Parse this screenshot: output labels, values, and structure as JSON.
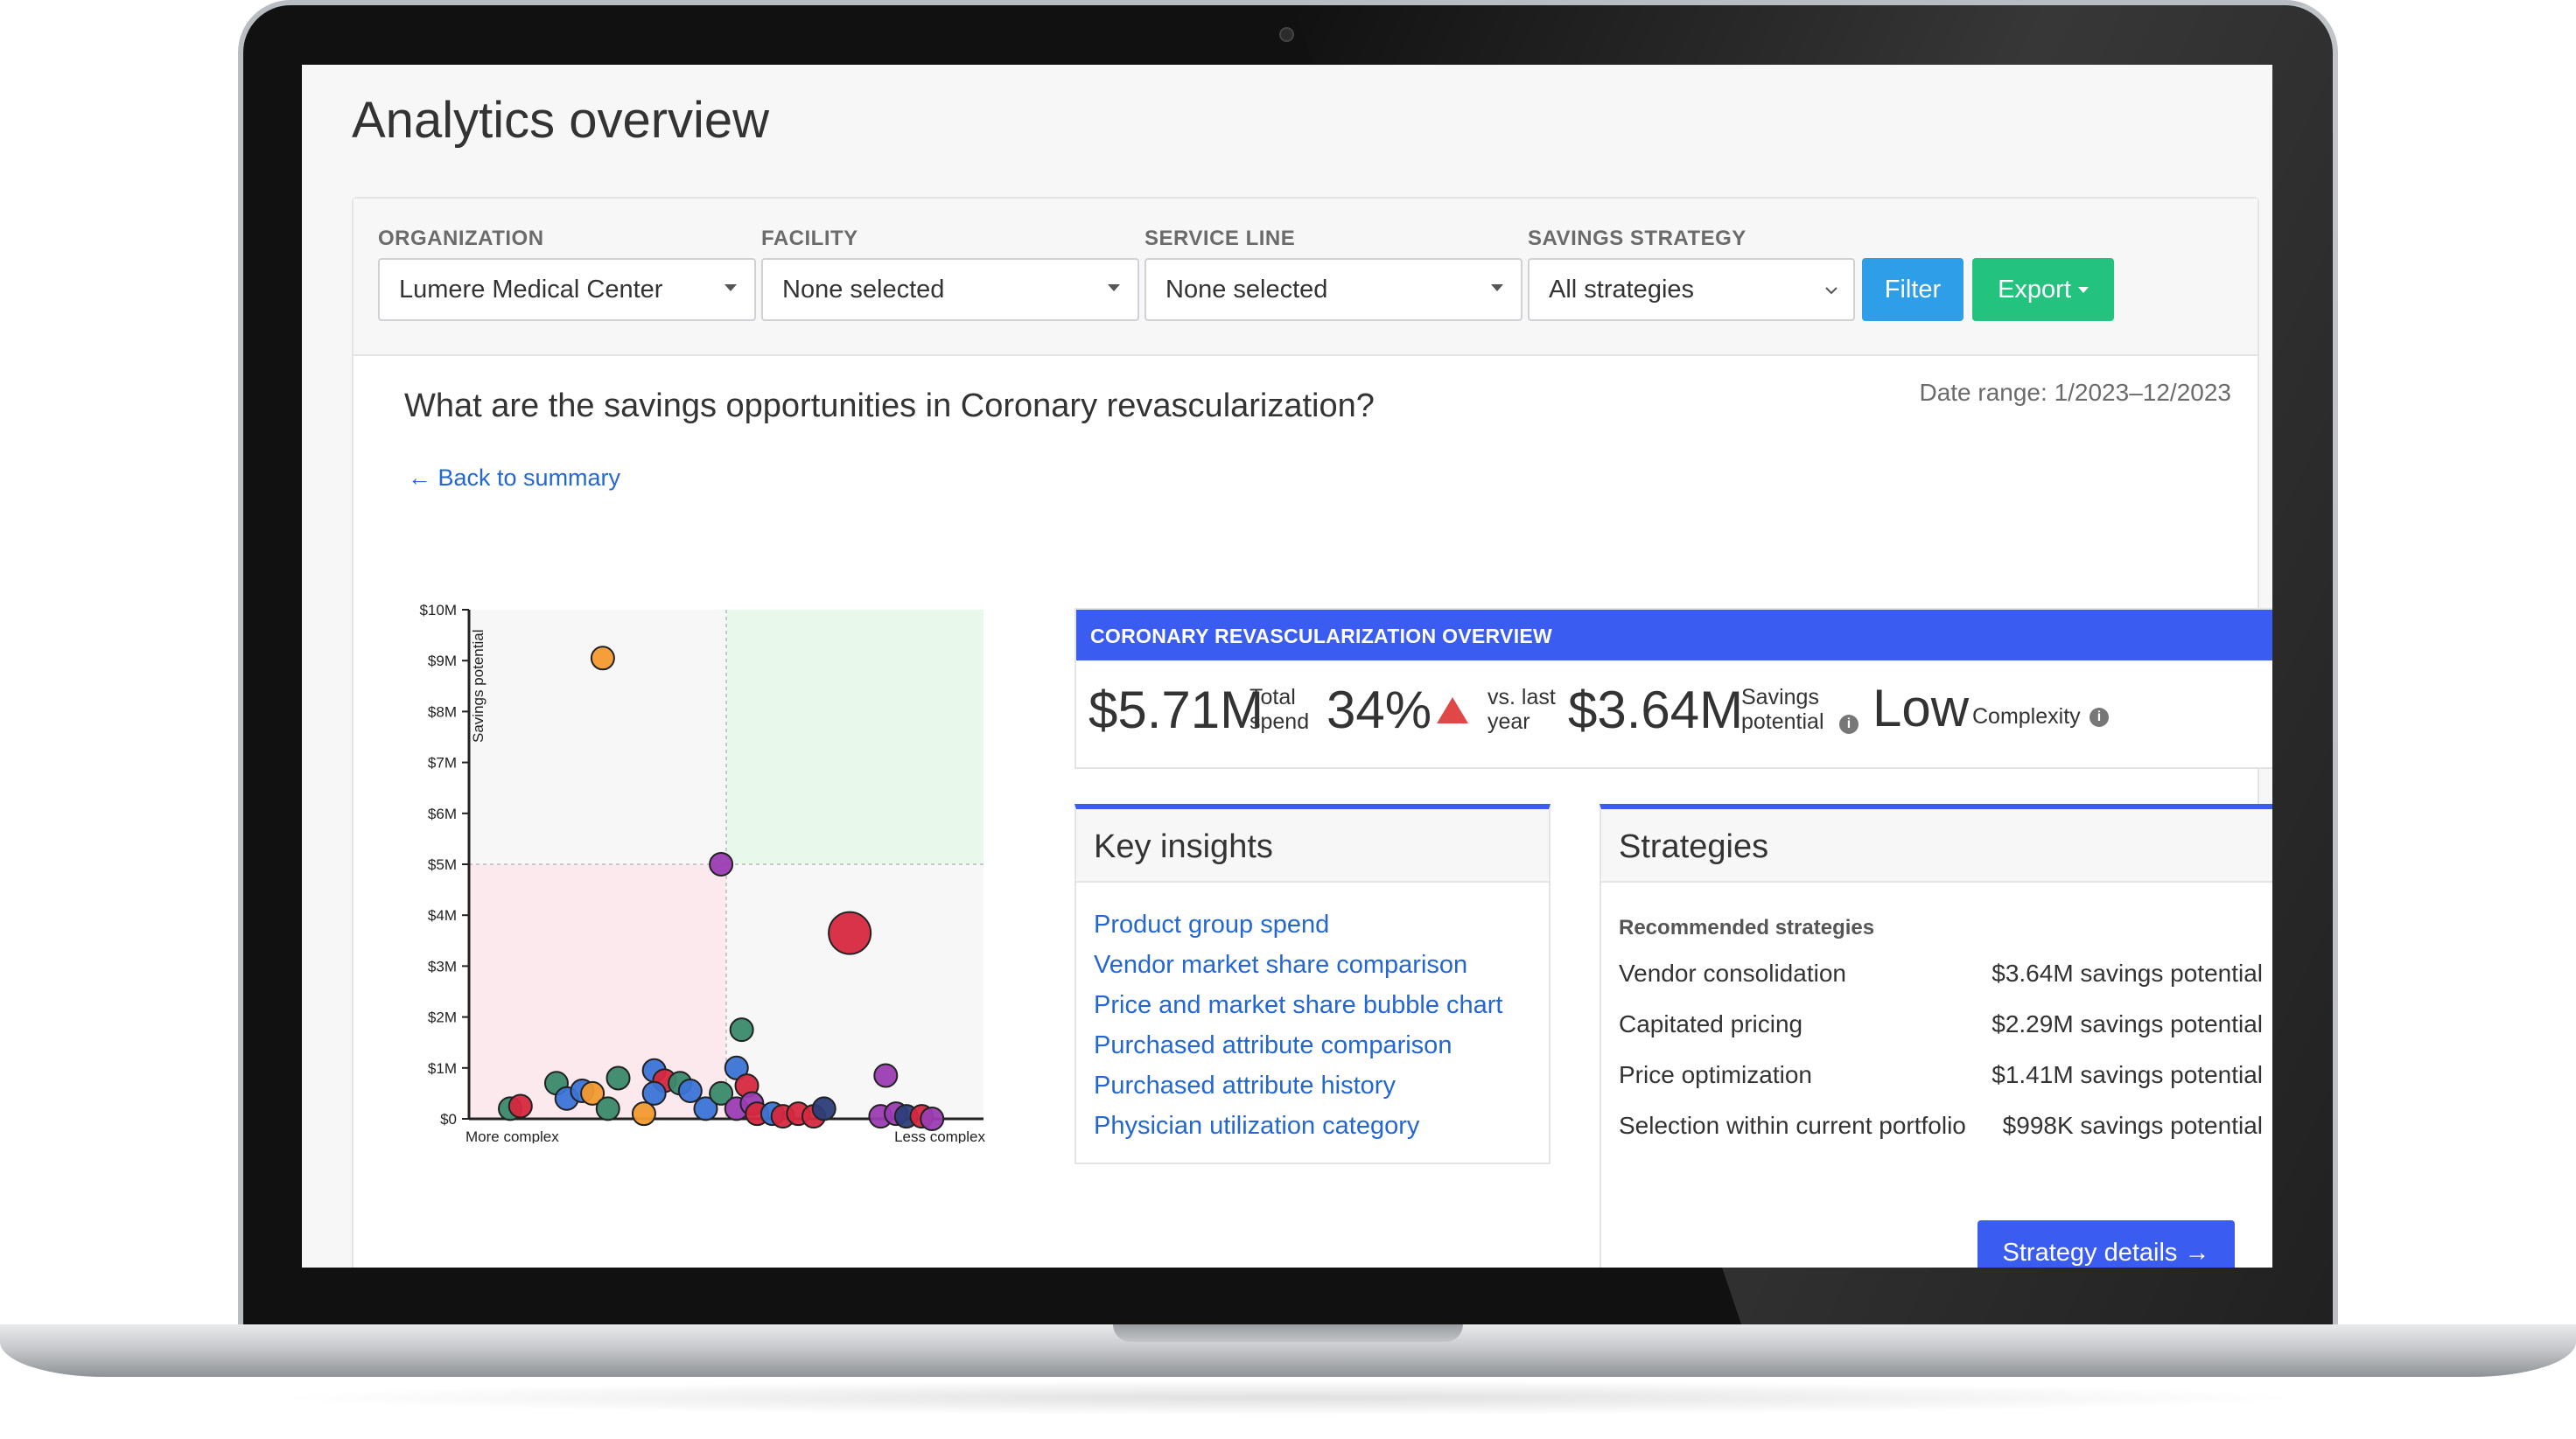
{
  "page": {
    "title": "Analytics overview"
  },
  "filters": {
    "organization": {
      "label": "ORGANIZATION",
      "value": "Lumere Medical Center"
    },
    "facility": {
      "label": "FACILITY",
      "value": "None selected"
    },
    "service_line": {
      "label": "SERVICE LINE",
      "value": "None selected"
    },
    "savings_strategy": {
      "label": "SAVINGS STRATEGY",
      "value": "All strategies"
    },
    "filter_button": "Filter",
    "export_button": "Export"
  },
  "header": {
    "question": "What are the savings opportunities in Coronary revascularization?",
    "date_range": "Date range: 1/2023–12/2023",
    "back_link": "← Back to summary"
  },
  "overview": {
    "title": "CORONARY REVASCULARIZATION OVERVIEW",
    "total_spend": {
      "value": "$5.71M",
      "label_1": "Total",
      "label_2": "spend"
    },
    "change": {
      "value": "34%",
      "label_1": "vs. last",
      "label_2": "year",
      "direction": "up"
    },
    "savings_potential": {
      "value": "$3.64M",
      "label_1": "Savings",
      "label_2": "potential"
    },
    "complexity": {
      "value": "Low",
      "label": "Complexity"
    },
    "info_icon_glyph": "i"
  },
  "insights": {
    "title": "Key insights",
    "items": [
      "Product group spend",
      "Vendor market share comparison",
      "Price and market share bubble chart",
      "Purchased attribute comparison",
      "Purchased attribute history",
      "Physician utilization category"
    ]
  },
  "strategies": {
    "title": "Strategies",
    "subtitle": "Recommended strategies",
    "items": [
      {
        "name": "Vendor consolidation",
        "value": "$3.64M savings potential"
      },
      {
        "name": "Capitated pricing",
        "value": "$2.29M savings potential"
      },
      {
        "name": "Price optimization",
        "value": "$1.41M savings potential"
      },
      {
        "name": "Selection within current portfolio",
        "value": "$998K savings potential"
      }
    ],
    "details_button": "Strategy details →"
  },
  "colors": {
    "primary_blue": "#3b5cf0",
    "filter_blue": "#2d9ee7",
    "export_green": "#24c27f",
    "link_blue": "#2467d4",
    "alert_red": "#e04848"
  },
  "chart_data": {
    "type": "scatter",
    "ylabel": "Savings potential",
    "x_axis_labels": [
      "More complex",
      "Less complex"
    ],
    "y_ticks": [
      "$0",
      "$1M",
      "$2M",
      "$3M",
      "$4M",
      "$5M",
      "$6M",
      "$7M",
      "$8M",
      "$9M",
      "$10M"
    ],
    "ylim": [
      0,
      10
    ],
    "xlim": [
      0,
      1
    ],
    "x_split": 0.5,
    "y_split": 5,
    "quadrant_colors": {
      "top_right": "#e8f8ea",
      "bottom_left": "#fce9ee",
      "other": "#f7f7f8"
    },
    "points": [
      {
        "x": 0.26,
        "y": 9.05,
        "size": 1,
        "color": "#f39a2e"
      },
      {
        "x": 0.49,
        "y": 5.0,
        "size": 1,
        "color": "#9b3cb3"
      },
      {
        "x": 0.74,
        "y": 3.65,
        "size": 2,
        "color": "#d6283e"
      },
      {
        "x": 0.53,
        "y": 1.75,
        "size": 1,
        "color": "#3a8a6a"
      },
      {
        "x": 0.81,
        "y": 0.85,
        "size": 1,
        "color": "#9b3cb3"
      },
      {
        "x": 0.08,
        "y": 0.2,
        "size": 1,
        "color": "#3a8a6a"
      },
      {
        "x": 0.1,
        "y": 0.25,
        "size": 1,
        "color": "#d6283e"
      },
      {
        "x": 0.17,
        "y": 0.7,
        "size": 1,
        "color": "#3a8a6a"
      },
      {
        "x": 0.19,
        "y": 0.4,
        "size": 1,
        "color": "#3b74d6"
      },
      {
        "x": 0.22,
        "y": 0.55,
        "size": 1,
        "color": "#3b74d6"
      },
      {
        "x": 0.24,
        "y": 0.5,
        "size": 1,
        "color": "#f39a2e"
      },
      {
        "x": 0.27,
        "y": 0.2,
        "size": 1,
        "color": "#3a8a6a"
      },
      {
        "x": 0.29,
        "y": 0.8,
        "size": 1,
        "color": "#3a8a6a"
      },
      {
        "x": 0.34,
        "y": 0.1,
        "size": 1,
        "color": "#f39a2e"
      },
      {
        "x": 0.36,
        "y": 0.95,
        "size": 1,
        "color": "#3b74d6"
      },
      {
        "x": 0.38,
        "y": 0.75,
        "size": 1,
        "color": "#d6283e"
      },
      {
        "x": 0.36,
        "y": 0.5,
        "size": 1,
        "color": "#3b74d6"
      },
      {
        "x": 0.41,
        "y": 0.7,
        "size": 1,
        "color": "#3a8a6a"
      },
      {
        "x": 0.43,
        "y": 0.55,
        "size": 1,
        "color": "#3b74d6"
      },
      {
        "x": 0.46,
        "y": 0.2,
        "size": 1,
        "color": "#3b74d6"
      },
      {
        "x": 0.49,
        "y": 0.5,
        "size": 1,
        "color": "#3a8a6a"
      },
      {
        "x": 0.52,
        "y": 1.0,
        "size": 1,
        "color": "#3b74d6"
      },
      {
        "x": 0.52,
        "y": 0.2,
        "size": 1,
        "color": "#9b3cb3"
      },
      {
        "x": 0.54,
        "y": 0.65,
        "size": 1,
        "color": "#d6283e"
      },
      {
        "x": 0.55,
        "y": 0.3,
        "size": 1,
        "color": "#9b3cb3"
      },
      {
        "x": 0.56,
        "y": 0.1,
        "size": 1,
        "color": "#d6283e"
      },
      {
        "x": 0.59,
        "y": 0.1,
        "size": 1,
        "color": "#3b74d6"
      },
      {
        "x": 0.61,
        "y": 0.05,
        "size": 1,
        "color": "#d6283e"
      },
      {
        "x": 0.64,
        "y": 0.1,
        "size": 1,
        "color": "#d6283e"
      },
      {
        "x": 0.67,
        "y": 0.05,
        "size": 1,
        "color": "#d6283e"
      },
      {
        "x": 0.69,
        "y": 0.2,
        "size": 1,
        "color": "#2c3e7a"
      },
      {
        "x": 0.8,
        "y": 0.05,
        "size": 1,
        "color": "#9b3cb3"
      },
      {
        "x": 0.83,
        "y": 0.1,
        "size": 1,
        "color": "#9b3cb3"
      },
      {
        "x": 0.85,
        "y": 0.05,
        "size": 1,
        "color": "#2c3e7a"
      },
      {
        "x": 0.88,
        "y": 0.05,
        "size": 1,
        "color": "#d6283e"
      },
      {
        "x": 0.9,
        "y": 0.0,
        "size": 1,
        "color": "#9b3cb3"
      }
    ]
  }
}
